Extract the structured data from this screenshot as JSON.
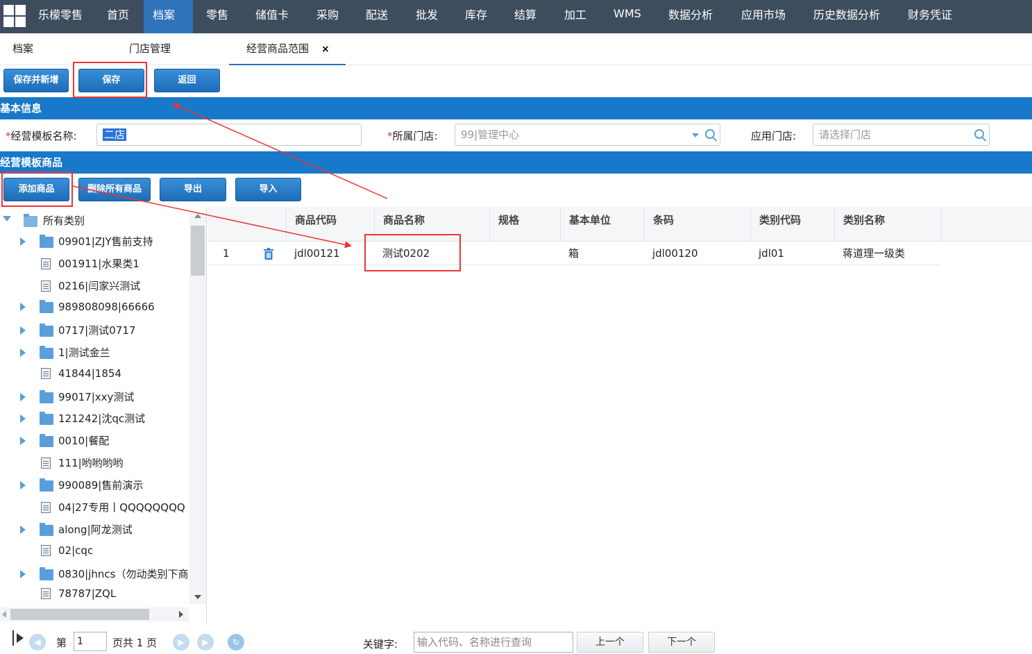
{
  "nav": {
    "brand": "乐檬零售",
    "items": [
      "首页",
      "档案",
      "零售",
      "储值卡",
      "采购",
      "配送",
      "批发",
      "库存",
      "结算",
      "加工",
      "WMS",
      "数据分析",
      "应用市场",
      "历史数据分析",
      "财务凭证"
    ]
  },
  "tabs": {
    "items": [
      "档案",
      "门店管理",
      "经营商品范围"
    ],
    "close_label": "×"
  },
  "toolbar": {
    "save_new_label": "保存并新增",
    "save_label": "保存",
    "back_label": "返回"
  },
  "basic_info": {
    "title": "基本信息",
    "template_name_label": "经营模板名称:",
    "template_name_value": "二店",
    "store_label": "所属门店:",
    "store_value": "99|管理中心",
    "apply_store_label": "应用门店:",
    "apply_store_placeholder": "请选择门店"
  },
  "template_goods": {
    "title": "经营模板商品",
    "add_label": "添加商品",
    "delete_all_label": "删除所有商品",
    "export_label": "导出",
    "import_label": "导入"
  },
  "tree": {
    "root": "所有类别",
    "items": [
      {
        "label": "09901|ZJY售前支持",
        "type": "folder"
      },
      {
        "label": "001911|水果类1",
        "type": "doc"
      },
      {
        "label": "0216|闫家兴测试",
        "type": "doc"
      },
      {
        "label": "989808098|66666",
        "type": "folder"
      },
      {
        "label": "0717|测试0717",
        "type": "folder"
      },
      {
        "label": "1|测试金兰",
        "type": "folder"
      },
      {
        "label": "41844|1854",
        "type": "doc"
      },
      {
        "label": "99017|xxy测试",
        "type": "folder"
      },
      {
        "label": "121242|沈qc测试",
        "type": "folder"
      },
      {
        "label": "0010|餐配",
        "type": "folder"
      },
      {
        "label": "111|哟哟哟哟",
        "type": "doc"
      },
      {
        "label": "990089|售前演示",
        "type": "folder"
      },
      {
        "label": "04|27专用丨QQQQQQQQ",
        "type": "doc"
      },
      {
        "label": "along|阿龙测试",
        "type": "folder"
      },
      {
        "label": "02|cqc",
        "type": "doc"
      },
      {
        "label": "0830|jhncs（勿动类别下商",
        "type": "folder"
      },
      {
        "label": "78787|ZQL",
        "type": "doc"
      }
    ]
  },
  "table": {
    "columns": [
      "商品代码",
      "商品名称",
      "规格",
      "基本单位",
      "条码",
      "类别代码",
      "类别名称"
    ],
    "rows": [
      {
        "index": "1",
        "code": "jdl00121",
        "name": "测试0202",
        "spec": "",
        "unit": "箱",
        "barcode": "jdl00120",
        "cat_code": "jdl01",
        "cat_name": "蒋道理一级类"
      }
    ]
  },
  "pager": {
    "page_prefix": "第",
    "page_value": "1",
    "page_suffix": "页共 1 页",
    "keyword_label": "关键字:",
    "keyword_placeholder": "输入代码、名称进行查询",
    "prev_label": "上一个",
    "next_label": "下一个"
  },
  "colors": {
    "nav_bg": "#3d4d5e",
    "accent": "#1878c9",
    "annotation": "#e33333"
  }
}
